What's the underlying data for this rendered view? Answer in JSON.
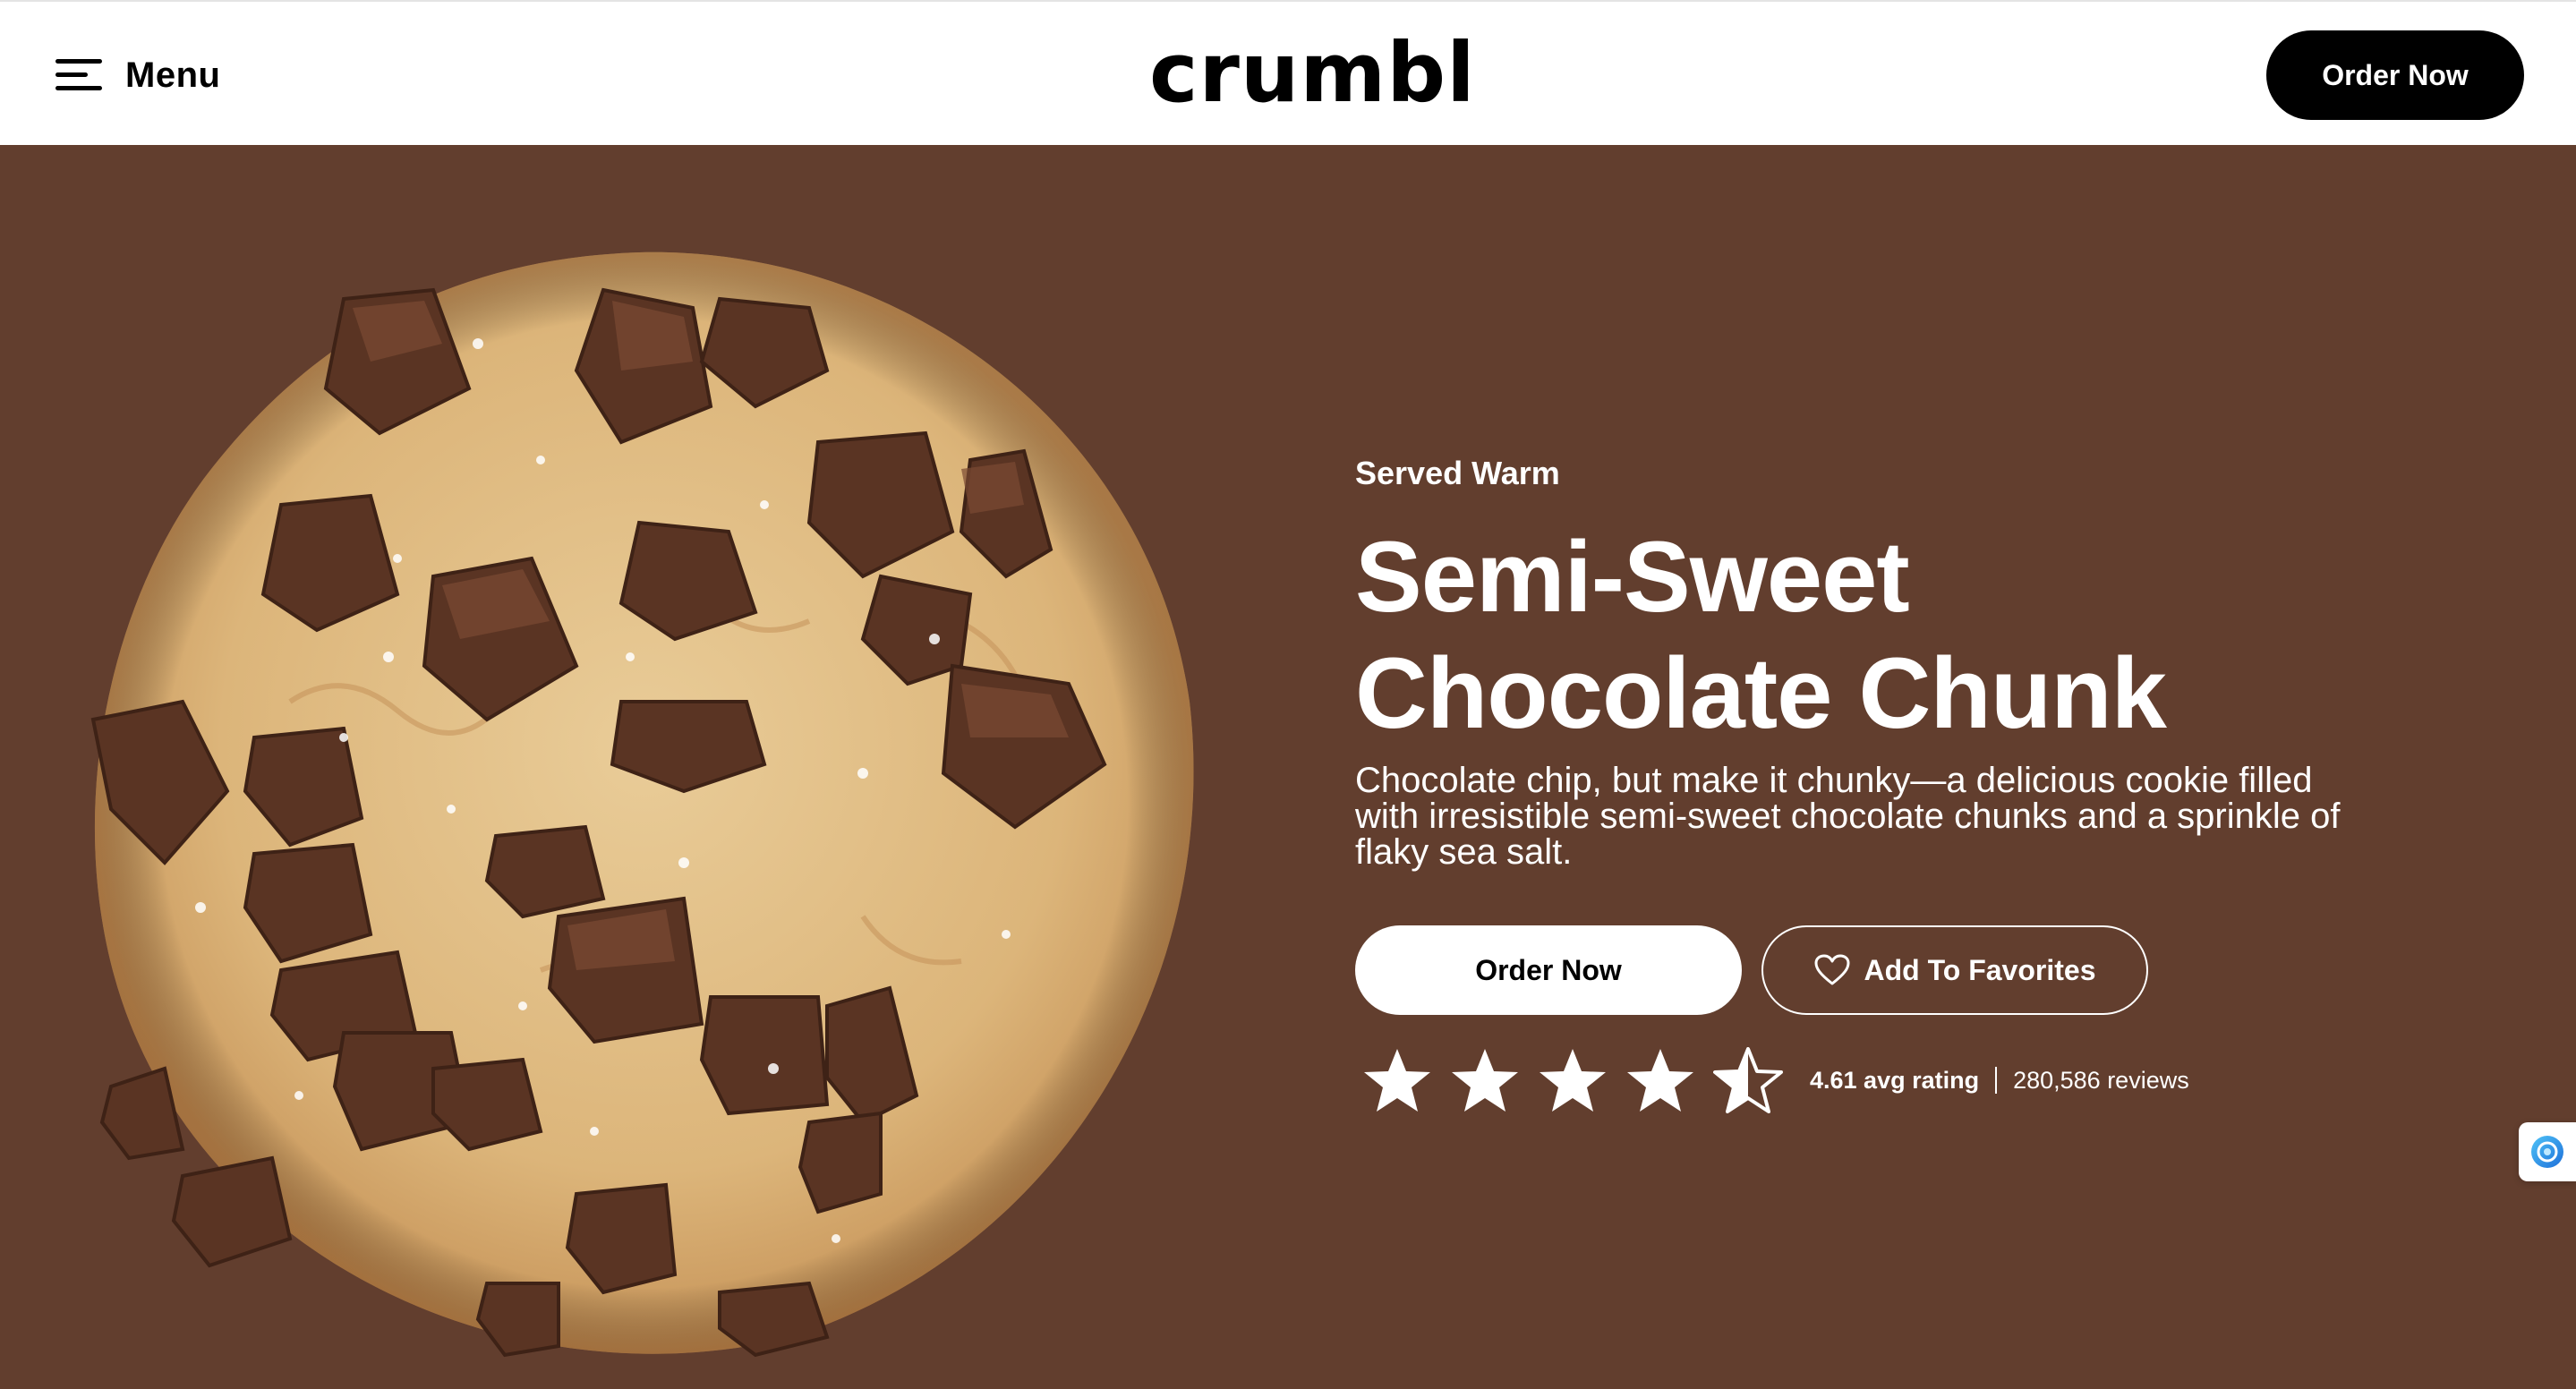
{
  "header": {
    "menu_label": "Menu",
    "logo_text": "crumbl",
    "order_button": "Order Now"
  },
  "hero": {
    "eyebrow": "Served Warm",
    "title_line1": "Semi-Sweet",
    "title_line2": "Chocolate Chunk",
    "description": "Chocolate chip, but make it chunky—a delicious cookie filled with irresistible semi-sweet chocolate chunks and a sprinkle of flaky sea salt.",
    "order_button": "Order Now",
    "favorites_button": "Add To Favorites",
    "rating_value": 4.61,
    "rating_label": "4.61 avg rating",
    "reviews_label": "280,586 reviews",
    "stars_filled_out_of_5": 4.61
  },
  "colors": {
    "hero_background": "#623e2e",
    "header_background": "#ffffff",
    "primary_button": "#000000",
    "text_on_hero": "#ffffff"
  },
  "icons": {
    "menu": "hamburger-icon",
    "favorite": "heart-icon",
    "rating": "star-icon",
    "side_widget": "assistant-icon"
  }
}
